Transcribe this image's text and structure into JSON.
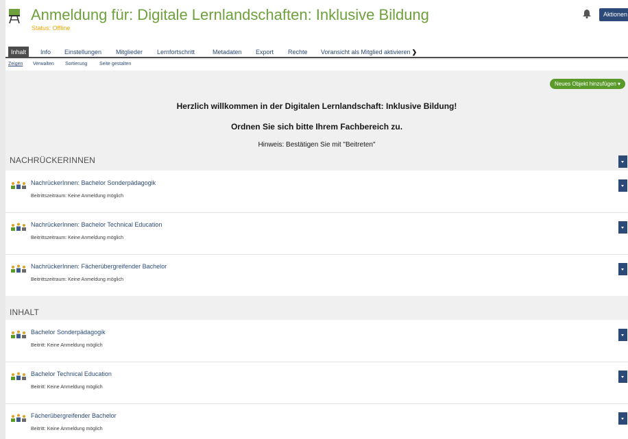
{
  "header": {
    "title": "Anmeldung für: Digitale Lernlandschaften: Inklusive Bildung",
    "status": "Status: Offline",
    "actions_label": "Aktionen ▾",
    "icons": {
      "course": "chalkboard-icon",
      "notifications": "bell-icon"
    }
  },
  "tabs": [
    {
      "label": "Inhalt",
      "active": true
    },
    {
      "label": "Info"
    },
    {
      "label": "Einstellungen"
    },
    {
      "label": "Mitglieder"
    },
    {
      "label": "Lernfortschritt"
    },
    {
      "label": "Metadaten"
    },
    {
      "label": "Export"
    },
    {
      "label": "Rechte"
    },
    {
      "label": "Voransicht als Mitglied aktivieren"
    }
  ],
  "subtabs": [
    {
      "label": "Zeigen",
      "active": true
    },
    {
      "label": "Verwalten"
    },
    {
      "label": "Sortierung"
    },
    {
      "label": "Seite gestalten"
    }
  ],
  "add_button": "Neues Objekt hinzufügen ▾",
  "welcome": {
    "line1": "Herzlich willkommen in der Digitalen Lernlandschaft: Inklusive Bildung!",
    "line2": "Ordnen Sie sich bitte Ihrem Fachbereich zu.",
    "hint": "Hinweis: Bestätigen Sie mit \"Beitreten\""
  },
  "sections": [
    {
      "title": "NACHRÜCKERINNEN",
      "items": [
        {
          "title": "NachrückerInnen: Bachelor Sonderpädagogik",
          "sub": "Beitrittszeitraum: Keine Anmeldung möglich"
        },
        {
          "title": "NachrückerInnen: Bachelor Technical Education",
          "sub": "Beitrittszeitraum: Keine Anmeldung möglich"
        },
        {
          "title": "NachrückerInnen: Fächerübergreifender Bachelor",
          "sub": "Beitrittszeitraum: Keine Anmeldung möglich"
        }
      ]
    },
    {
      "title": "INHALT",
      "items": [
        {
          "title": "Bachelor Sonderpädagogik",
          "sub": "Beitritt: Keine Anmeldung möglich"
        },
        {
          "title": "Bachelor Technical Education",
          "sub": "Beitritt: Keine Anmeldung möglich"
        },
        {
          "title": "Fächerübergreifender Bachelor",
          "sub": "Beitritt: Keine Anmeldung möglich"
        }
      ]
    }
  ],
  "colors": {
    "accent": "#6ea03c",
    "link": "#2c4a78",
    "status": "#f0a400",
    "button_green": "#5a9a2b"
  }
}
